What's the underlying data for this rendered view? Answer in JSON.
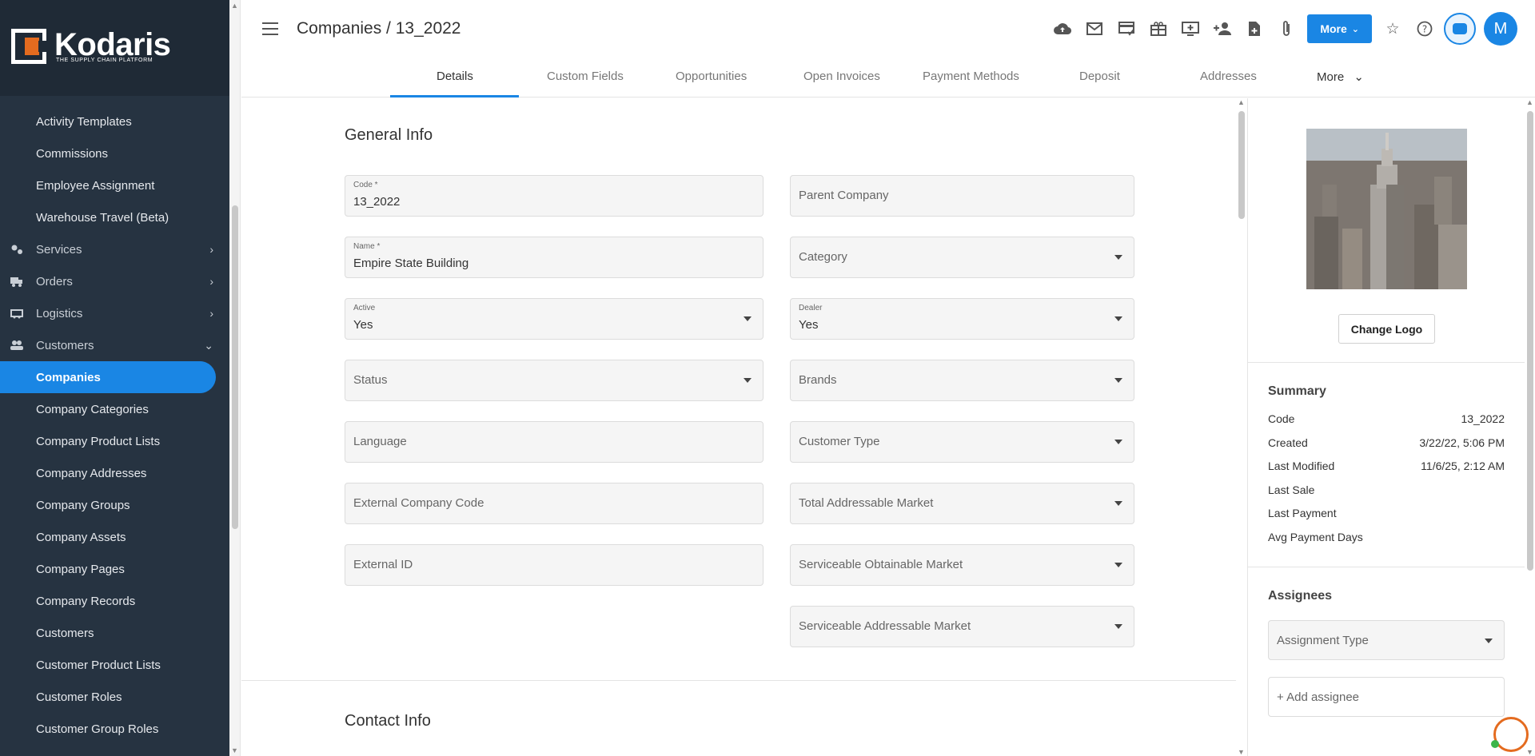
{
  "brand": {
    "name": "Kodaris",
    "tagline": "THE SUPPLY CHAIN PLATFORM",
    "accent": "#1a86e4",
    "logo_orange": "#e46b1f"
  },
  "sidebar": {
    "items": [
      {
        "label": "Activity Templates",
        "type": "child"
      },
      {
        "label": "Commissions",
        "type": "child"
      },
      {
        "label": "Employee Assignment",
        "type": "child"
      },
      {
        "label": "Warehouse Travel (Beta)",
        "type": "child"
      },
      {
        "label": "Services",
        "type": "group",
        "icon": "services-icon",
        "expanded": false
      },
      {
        "label": "Orders",
        "type": "group",
        "icon": "truck-icon",
        "expanded": false
      },
      {
        "label": "Logistics",
        "type": "group",
        "icon": "logistics-icon",
        "expanded": false
      },
      {
        "label": "Customers",
        "type": "group",
        "icon": "people-icon",
        "expanded": true
      },
      {
        "label": "Companies",
        "type": "child",
        "active": true
      },
      {
        "label": "Company Categories",
        "type": "child"
      },
      {
        "label": "Company Product Lists",
        "type": "child"
      },
      {
        "label": "Company Addresses",
        "type": "child"
      },
      {
        "label": "Company Groups",
        "type": "child"
      },
      {
        "label": "Company Assets",
        "type": "child"
      },
      {
        "label": "Company Pages",
        "type": "child"
      },
      {
        "label": "Company Records",
        "type": "child"
      },
      {
        "label": "Customers",
        "type": "child"
      },
      {
        "label": "Customer Product Lists",
        "type": "child"
      },
      {
        "label": "Customer Roles",
        "type": "child"
      },
      {
        "label": "Customer Group Roles",
        "type": "child"
      }
    ]
  },
  "header": {
    "title": "Companies / 13_2022",
    "more_label": "More",
    "avatar_initial": "M",
    "icons": [
      "cloud-upload-icon",
      "mail-icon",
      "payment-icon",
      "gift-icon",
      "add-screen-icon",
      "add-person-icon",
      "add-document-icon",
      "attachment-icon"
    ]
  },
  "tabs": [
    "Details",
    "Custom Fields",
    "Opportunities",
    "Open Invoices",
    "Payment Methods",
    "Deposit",
    "Addresses",
    "More"
  ],
  "form": {
    "general_title": "General Info",
    "contact_title": "Contact Info",
    "code": {
      "label": "Code *",
      "value": "13_2022"
    },
    "name": {
      "label": "Name *",
      "value": "Empire State Building"
    },
    "active": {
      "label": "Active",
      "value": "Yes"
    },
    "status": {
      "placeholder": "Status"
    },
    "language": {
      "placeholder": "Language"
    },
    "external_code": {
      "placeholder": "External Company Code"
    },
    "external_id": {
      "placeholder": "External ID"
    },
    "parent_company": {
      "placeholder": "Parent Company"
    },
    "category": {
      "placeholder": "Category"
    },
    "dealer": {
      "label": "Dealer",
      "value": "Yes"
    },
    "brands": {
      "placeholder": "Brands"
    },
    "customer_type": {
      "placeholder": "Customer Type"
    },
    "tam": {
      "placeholder": "Total Addressable Market"
    },
    "som": {
      "placeholder": "Serviceable Obtainable Market"
    },
    "sam": {
      "placeholder": "Serviceable Addressable Market"
    }
  },
  "right_panel": {
    "change_logo": "Change Logo",
    "summary_title": "Summary",
    "summary": [
      {
        "label": "Code",
        "value": "13_2022"
      },
      {
        "label": "Created",
        "value": "3/22/22, 5:06 PM"
      },
      {
        "label": "Last Modified",
        "value": "11/6/25, 2:12 AM"
      },
      {
        "label": "Last Sale",
        "value": ""
      },
      {
        "label": "Last Payment",
        "value": ""
      },
      {
        "label": "Avg Payment Days",
        "value": ""
      }
    ],
    "assignees_title": "Assignees",
    "assignment_type_placeholder": "Assignment Type",
    "add_assignee": "+ Add assignee"
  }
}
